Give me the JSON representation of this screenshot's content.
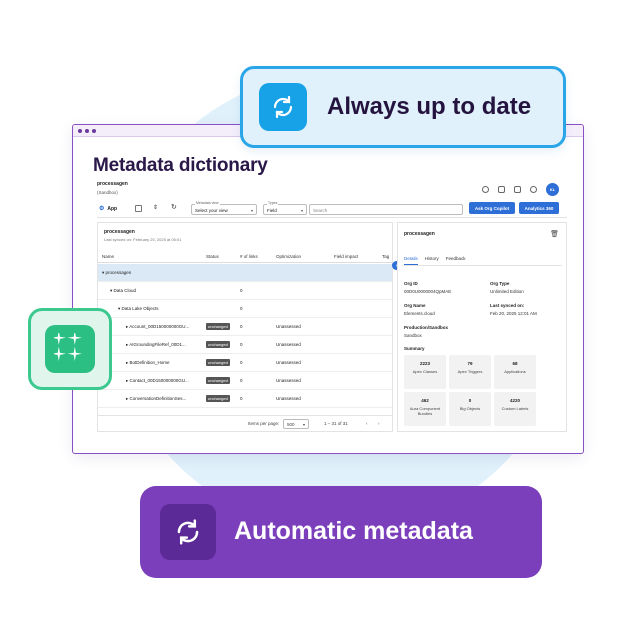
{
  "callouts": {
    "top": "Always up to date",
    "bottom": "Automatic metadata"
  },
  "colors": {
    "accent_blue": "#2d6fd6",
    "callout_blue": "#2aa6e8",
    "callout_green": "#3cc98f",
    "callout_purple": "#7b3fbc"
  },
  "window": {
    "title": "Metadata dictionary"
  },
  "app": {
    "org": "processagen",
    "env": "(Sandbox)",
    "avatar": "KL",
    "toolbar": {
      "app_label": "App",
      "metadata_view_label": "Metadata view",
      "metadata_view_value": "Select your view",
      "types_label": "Types",
      "types_value": "Field",
      "search_placeholder": "Search",
      "ask_button": "Ask Org Copilot",
      "analytics_button": "Analytics 360"
    },
    "tree": {
      "title": "processagen",
      "subtitle": "Last synced on: February 20, 2025 at 06:01",
      "columns": [
        "Name",
        "Status",
        "# of links",
        "Optimization",
        "Field impact",
        "Tag"
      ],
      "rows": [
        {
          "name": "▾  processagen",
          "status": "",
          "links": "",
          "opt": "",
          "indent": 4,
          "selected": true
        },
        {
          "name": "▾  Data Cloud",
          "status": "",
          "links": "0",
          "opt": "",
          "indent": 12,
          "selected": false
        },
        {
          "name": "▾  Data Lake Objects",
          "status": "",
          "links": "0",
          "opt": "",
          "indent": 20,
          "selected": false
        },
        {
          "name": "▸  Account_00D150000000GU...",
          "status": "unchanged",
          "links": "0",
          "opt": "Unassessed",
          "indent": 28,
          "selected": false
        },
        {
          "name": "▸  AIGroundingFileRef_00D1...",
          "status": "unchanged",
          "links": "0",
          "opt": "Unassessed",
          "indent": 28,
          "selected": false
        },
        {
          "name": "▸  BotDefinition_Home",
          "status": "unchanged",
          "links": "0",
          "opt": "Unassessed",
          "indent": 28,
          "selected": false
        },
        {
          "name": "▸  Contact_00D150000000GU...",
          "status": "unchanged",
          "links": "0",
          "opt": "Unassessed",
          "indent": 28,
          "selected": false
        },
        {
          "name": "▸  ConversationDefinitionSes...",
          "status": "unchanged",
          "links": "0",
          "opt": "Unassessed",
          "indent": 28,
          "selected": false
        }
      ],
      "pager": {
        "items_per_page_label": "Items per page:",
        "items_per_page": "500",
        "range": "1 – 31 of 31"
      }
    },
    "detail": {
      "title": "processagen",
      "tabs": [
        "Details",
        "History",
        "Feedback"
      ],
      "fields": [
        {
          "key": "Org ID",
          "value": "00D0U0000004QpMAE"
        },
        {
          "key": "Org Type",
          "value": "Unlimited Edition"
        },
        {
          "key": "Org Name",
          "value": "Elements.cloud"
        },
        {
          "key": "Last synced on:",
          "value": "Feb 20, 2025 12:01 AM"
        },
        {
          "key": "Production/Sandbox",
          "value": "Sandbox"
        }
      ],
      "summary_label": "Summary",
      "summary": [
        {
          "value": "2223",
          "label": "Apex Classes"
        },
        {
          "value": "79",
          "label": "Apex Triggers"
        },
        {
          "value": "68",
          "label": "Applications"
        },
        {
          "value": "462",
          "label": "Aura Component Bundles"
        },
        {
          "value": "0",
          "label": "Big Objects"
        },
        {
          "value": "4220",
          "label": "Custom Labels"
        }
      ]
    }
  }
}
